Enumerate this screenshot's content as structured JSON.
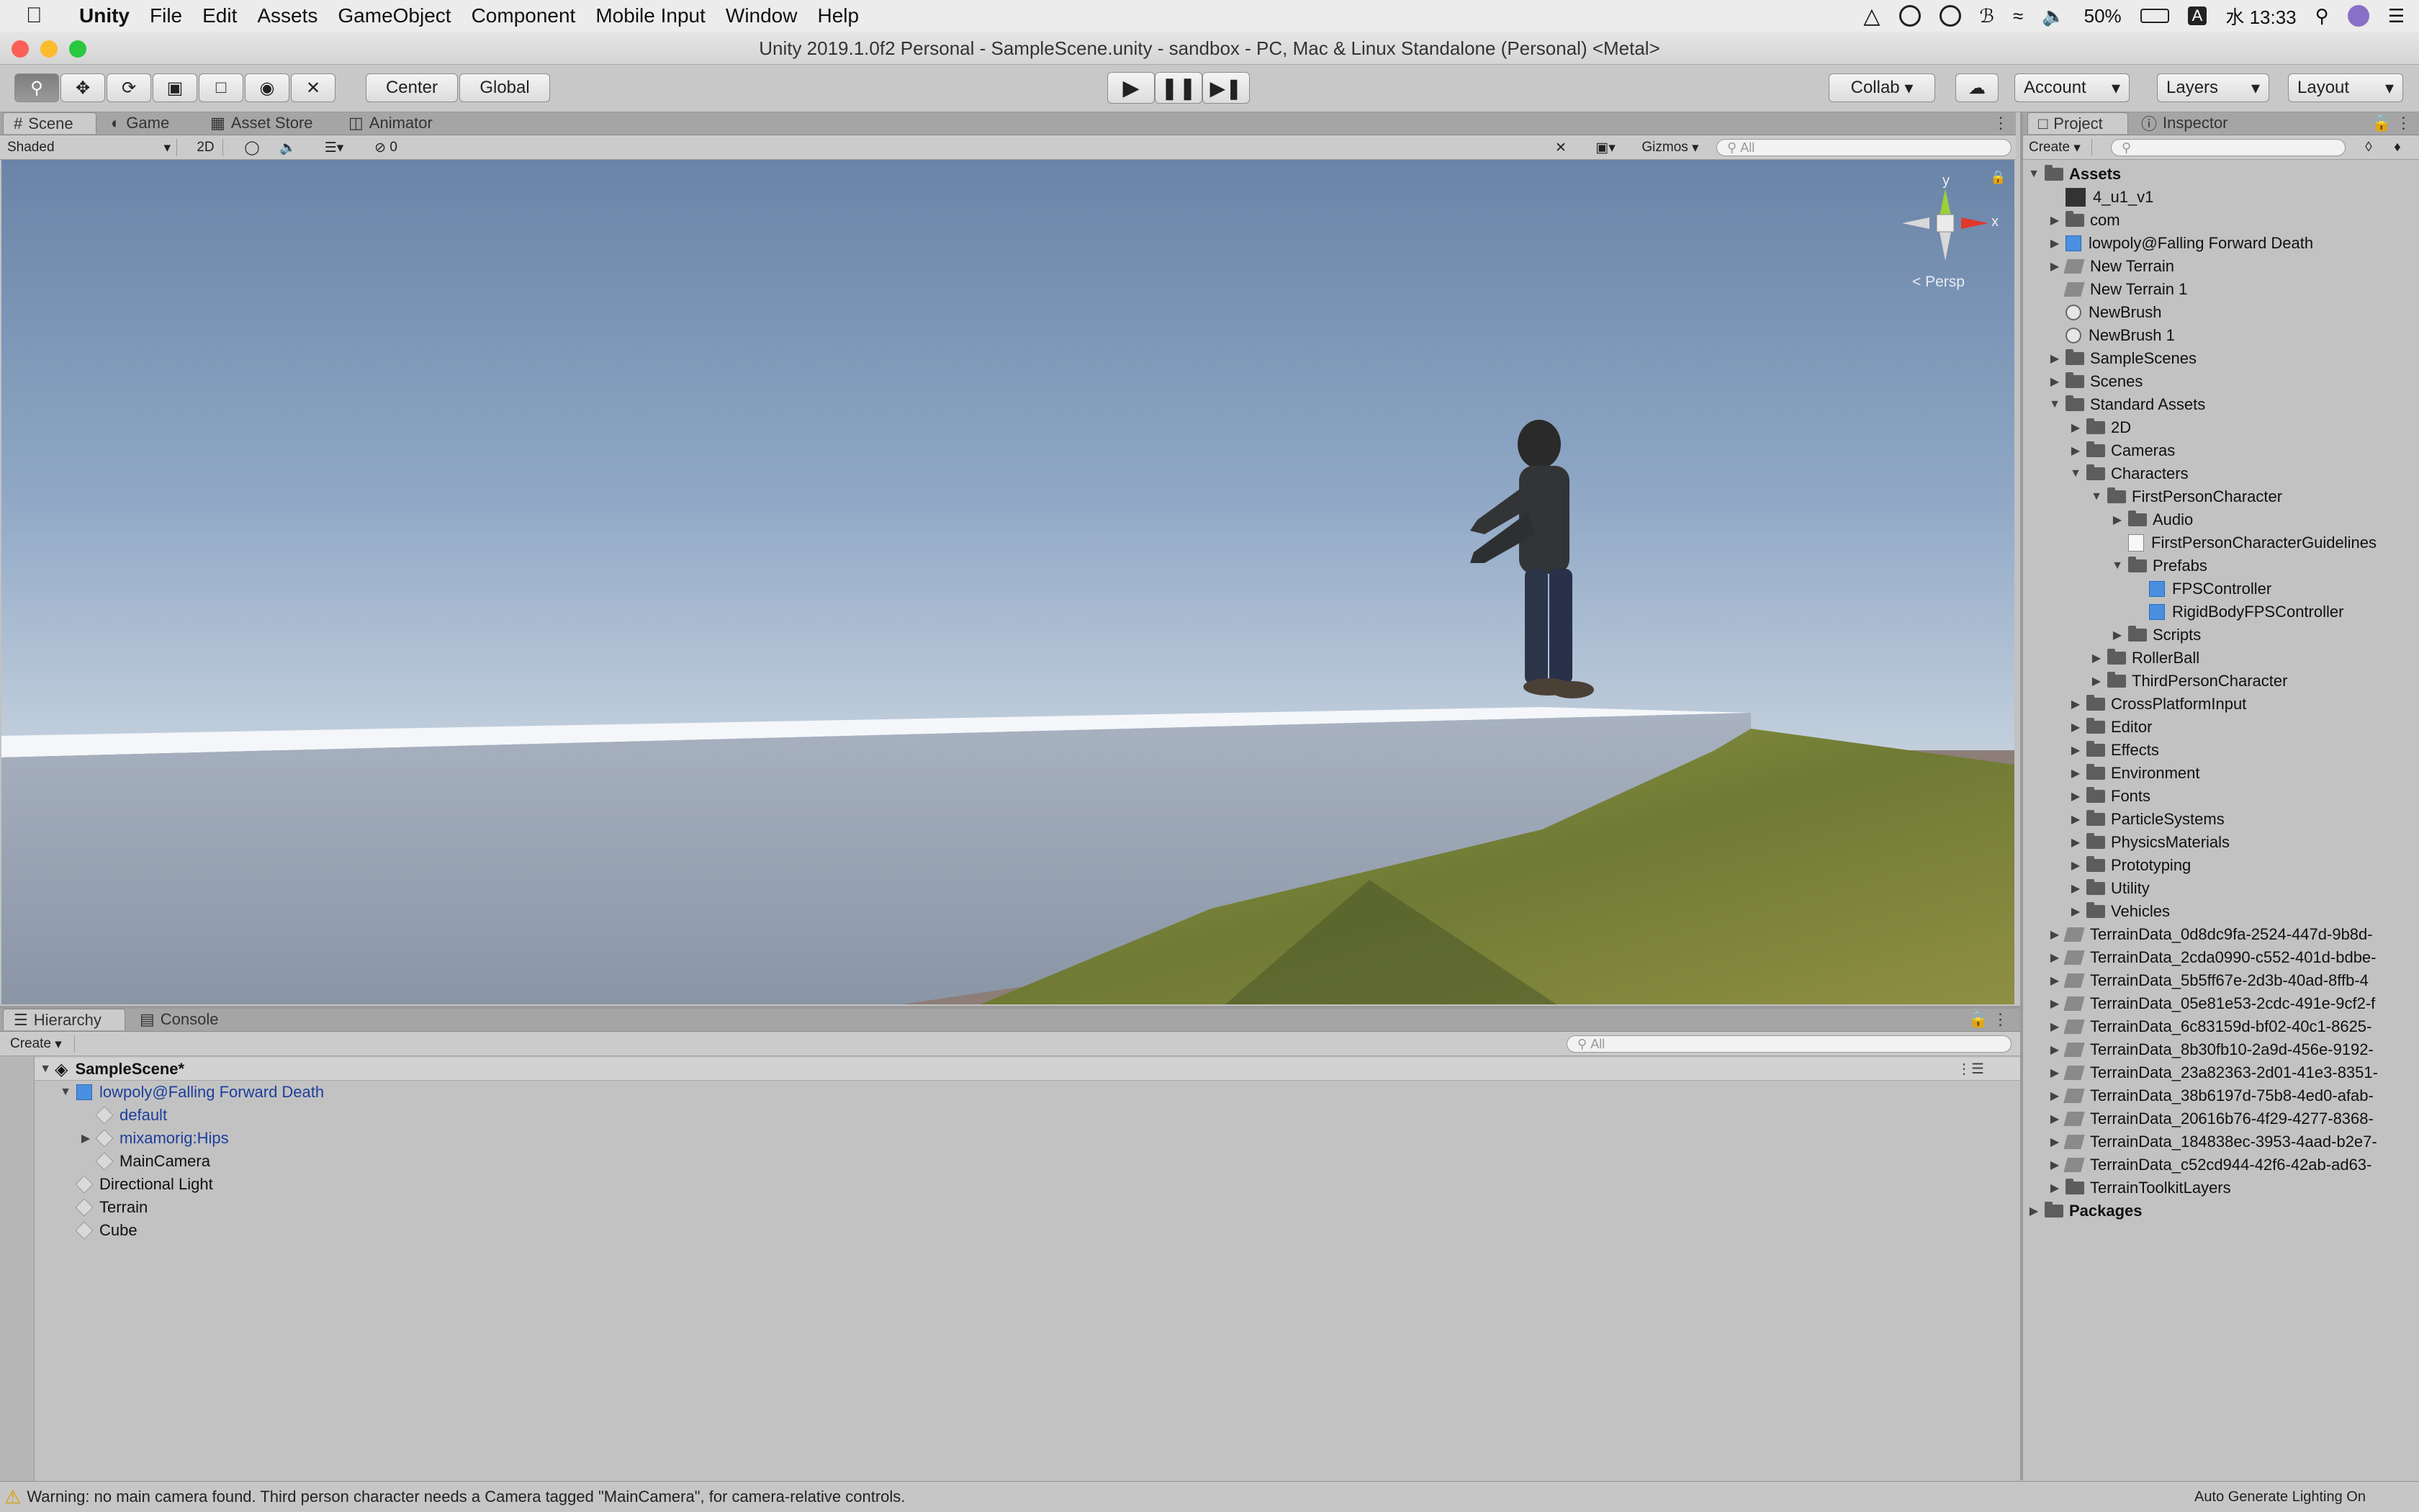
{
  "menubar": {
    "app": "Unity",
    "items": [
      "File",
      "Edit",
      "Assets",
      "GameObject",
      "Component",
      "Mobile Input",
      "Window",
      "Help"
    ],
    "battery": "50%",
    "clock": "水 13:33",
    "input_badge": "A"
  },
  "window": {
    "title": "Unity 2019.1.0f2 Personal - SampleScene.unity - sandbox - PC, Mac & Linux Standalone (Personal) <Metal>"
  },
  "toolbar": {
    "pivot": "Center",
    "space": "Global",
    "collab": "Collab",
    "account": "Account",
    "layers": "Layers",
    "layout": "Layout"
  },
  "scene_tabs": [
    "Scene",
    "Game",
    "Asset Store",
    "Animator"
  ],
  "scene_bar": {
    "draw_mode": "Shaded",
    "mode_2d": "2D",
    "hidden_count": "0",
    "gizmos": "Gizmos",
    "search_placeholder": "All"
  },
  "gizmo": {
    "y": "y",
    "x": "x",
    "persp": "< Persp"
  },
  "right_tabs": [
    "Project",
    "Inspector"
  ],
  "project": {
    "create": "Create",
    "tree": [
      {
        "label": "Assets",
        "depth": 0,
        "arrow": "▼",
        "icon": "fold",
        "bold": true
      },
      {
        "label": "4_u1_v1",
        "depth": 1,
        "arrow": "",
        "icon": "thumb"
      },
      {
        "label": "com",
        "depth": 1,
        "arrow": "▶",
        "icon": "fold"
      },
      {
        "label": "lowpoly@Falling Forward Death",
        "depth": 1,
        "arrow": "▶",
        "icon": "bluecube"
      },
      {
        "label": "New Terrain",
        "depth": 1,
        "arrow": "▶",
        "icon": "tdic"
      },
      {
        "label": "New Terrain 1",
        "depth": 1,
        "arrow": "",
        "icon": "tdic"
      },
      {
        "label": "NewBrush",
        "depth": 1,
        "arrow": "",
        "icon": "brush"
      },
      {
        "label": "NewBrush 1",
        "depth": 1,
        "arrow": "",
        "icon": "brush"
      },
      {
        "label": "SampleScenes",
        "depth": 1,
        "arrow": "▶",
        "icon": "fold"
      },
      {
        "label": "Scenes",
        "depth": 1,
        "arrow": "▶",
        "icon": "fold"
      },
      {
        "label": "Standard Assets",
        "depth": 1,
        "arrow": "▼",
        "icon": "fold"
      },
      {
        "label": "2D",
        "depth": 2,
        "arrow": "▶",
        "icon": "fold"
      },
      {
        "label": "Cameras",
        "depth": 2,
        "arrow": "▶",
        "icon": "fold"
      },
      {
        "label": "Characters",
        "depth": 2,
        "arrow": "▼",
        "icon": "fold"
      },
      {
        "label": "FirstPersonCharacter",
        "depth": 3,
        "arrow": "▼",
        "icon": "fold"
      },
      {
        "label": "Audio",
        "depth": 4,
        "arrow": "▶",
        "icon": "fold"
      },
      {
        "label": "FirstPersonCharacterGuidelines",
        "depth": 4,
        "arrow": "",
        "icon": "scriptic"
      },
      {
        "label": "Prefabs",
        "depth": 4,
        "arrow": "▼",
        "icon": "fold"
      },
      {
        "label": "FPSController",
        "depth": 5,
        "arrow": "",
        "icon": "bluecube"
      },
      {
        "label": "RigidBodyFPSController",
        "depth": 5,
        "arrow": "",
        "icon": "bluecube"
      },
      {
        "label": "Scripts",
        "depth": 4,
        "arrow": "▶",
        "icon": "fold"
      },
      {
        "label": "RollerBall",
        "depth": 3,
        "arrow": "▶",
        "icon": "fold"
      },
      {
        "label": "ThirdPersonCharacter",
        "depth": 3,
        "arrow": "▶",
        "icon": "fold"
      },
      {
        "label": "CrossPlatformInput",
        "depth": 2,
        "arrow": "▶",
        "icon": "fold"
      },
      {
        "label": "Editor",
        "depth": 2,
        "arrow": "▶",
        "icon": "fold"
      },
      {
        "label": "Effects",
        "depth": 2,
        "arrow": "▶",
        "icon": "fold"
      },
      {
        "label": "Environment",
        "depth": 2,
        "arrow": "▶",
        "icon": "fold"
      },
      {
        "label": "Fonts",
        "depth": 2,
        "arrow": "▶",
        "icon": "fold"
      },
      {
        "label": "ParticleSystems",
        "depth": 2,
        "arrow": "▶",
        "icon": "fold"
      },
      {
        "label": "PhysicsMaterials",
        "depth": 2,
        "arrow": "▶",
        "icon": "fold"
      },
      {
        "label": "Prototyping",
        "depth": 2,
        "arrow": "▶",
        "icon": "fold"
      },
      {
        "label": "Utility",
        "depth": 2,
        "arrow": "▶",
        "icon": "fold"
      },
      {
        "label": "Vehicles",
        "depth": 2,
        "arrow": "▶",
        "icon": "fold"
      },
      {
        "label": "TerrainData_0d8dc9fa-2524-447d-9b8d-",
        "depth": 1,
        "arrow": "▶",
        "icon": "tdic"
      },
      {
        "label": "TerrainData_2cda0990-c552-401d-bdbe-",
        "depth": 1,
        "arrow": "▶",
        "icon": "tdic"
      },
      {
        "label": "TerrainData_5b5ff67e-2d3b-40ad-8ffb-4",
        "depth": 1,
        "arrow": "▶",
        "icon": "tdic"
      },
      {
        "label": "TerrainData_05e81e53-2cdc-491e-9cf2-f",
        "depth": 1,
        "arrow": "▶",
        "icon": "tdic"
      },
      {
        "label": "TerrainData_6c83159d-bf02-40c1-8625-",
        "depth": 1,
        "arrow": "▶",
        "icon": "tdic"
      },
      {
        "label": "TerrainData_8b30fb10-2a9d-456e-9192-",
        "depth": 1,
        "arrow": "▶",
        "icon": "tdic"
      },
      {
        "label": "TerrainData_23a82363-2d01-41e3-8351-",
        "depth": 1,
        "arrow": "▶",
        "icon": "tdic"
      },
      {
        "label": "TerrainData_38b6197d-75b8-4ed0-afab-",
        "depth": 1,
        "arrow": "▶",
        "icon": "tdic"
      },
      {
        "label": "TerrainData_20616b76-4f29-4277-8368-",
        "depth": 1,
        "arrow": "▶",
        "icon": "tdic"
      },
      {
        "label": "TerrainData_184838ec-3953-4aad-b2e7-",
        "depth": 1,
        "arrow": "▶",
        "icon": "tdic"
      },
      {
        "label": "TerrainData_c52cd944-42f6-42ab-ad63-",
        "depth": 1,
        "arrow": "▶",
        "icon": "tdic"
      },
      {
        "label": "TerrainToolkitLayers",
        "depth": 1,
        "arrow": "▶",
        "icon": "fold"
      },
      {
        "label": "Packages",
        "depth": 0,
        "arrow": "▶",
        "icon": "fold",
        "bold": true
      }
    ]
  },
  "bottom_tabs": [
    "Hierarchy",
    "Console"
  ],
  "hierarchy": {
    "create": "Create",
    "search_placeholder": "All",
    "rows": [
      {
        "label": "SampleScene*",
        "depth": 0,
        "arrow": "▼",
        "icon": "unity",
        "bold": true
      },
      {
        "label": "lowpoly@Falling Forward Death",
        "depth": 1,
        "arrow": "▼",
        "icon": "bluecube",
        "blue": true
      },
      {
        "label": "default",
        "depth": 2,
        "arrow": "",
        "icon": "cube",
        "blue": true
      },
      {
        "label": "mixamorig:Hips",
        "depth": 2,
        "arrow": "▶",
        "icon": "cube",
        "blue": true
      },
      {
        "label": "MainCamera",
        "depth": 2,
        "arrow": "",
        "icon": "cube"
      },
      {
        "label": "Directional Light",
        "depth": 1,
        "arrow": "",
        "icon": "cube"
      },
      {
        "label": "Terrain",
        "depth": 1,
        "arrow": "",
        "icon": "cube"
      },
      {
        "label": "Cube",
        "depth": 1,
        "arrow": "",
        "icon": "cube"
      }
    ]
  },
  "status": {
    "warning": "Warning: no main camera found. Third person character needs a Camera tagged \"MainCamera\", for camera-relative controls.",
    "lighting": "Auto Generate Lighting On"
  }
}
